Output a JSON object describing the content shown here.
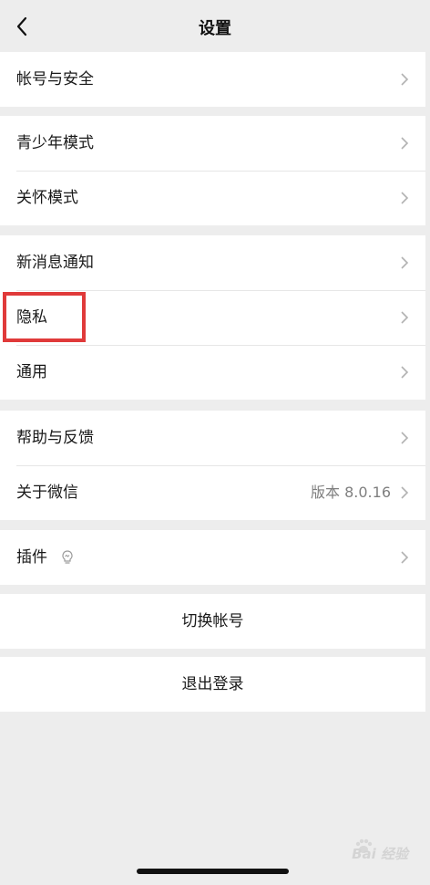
{
  "nav": {
    "title": "设置"
  },
  "groups": {
    "account": {
      "account_security": "帐号与安全"
    },
    "modes": {
      "youth_mode": "青少年模式",
      "care_mode": "关怀模式"
    },
    "general": {
      "notifications": "新消息通知",
      "privacy": "隐私",
      "general": "通用"
    },
    "support": {
      "help": "帮助与反馈",
      "about": "关于微信",
      "version": "版本 8.0.16"
    },
    "plugins": {
      "plugins": "插件"
    }
  },
  "actions": {
    "switch_account": "切换帐号",
    "logout": "退出登录"
  },
  "watermark": {
    "text": "Bai 经验"
  },
  "icons": {
    "back": "chevron-left-icon",
    "row_arrow": "chevron-right-icon",
    "plugin": "lightbulb-icon",
    "watermark_logo": "paw-icon"
  },
  "colors": {
    "page_background": "#ededed",
    "card_background": "#ffffff",
    "highlight_border": "#e03a3a",
    "secondary_text": "#7f7f7f"
  }
}
